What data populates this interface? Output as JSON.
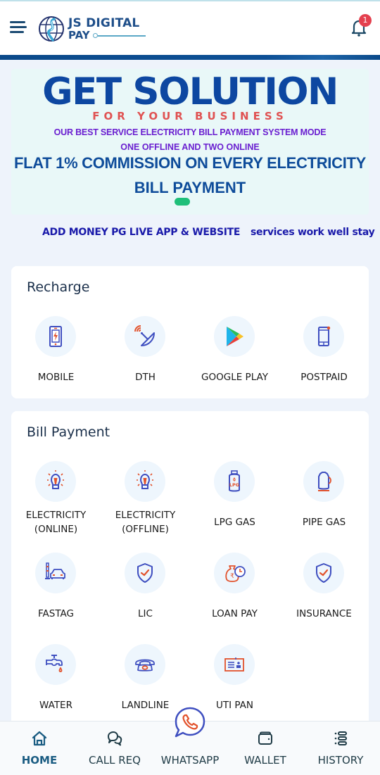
{
  "header": {
    "logo_line1": "JS DIGITAL",
    "logo_line2": "PAY",
    "notification_count": "1",
    "menu_icon": "hamburger-menu-icon",
    "bell_icon": "bell-icon"
  },
  "banner": {
    "title": "GET SOLUTION",
    "subtitle": "FOR YOUR BUSINESS",
    "line1": "OUR BEST SERVICE ELECTRICITY BILL PAYMENT SYSTEM MODE",
    "line2": "ONE OFFLINE AND TWO ONLINE",
    "line3": "FLAT 1% COMMISSION ON EVERY ELECTRICITY",
    "line4": "BILL PAYMENT",
    "active_slide_indicator": 1,
    "colors": {
      "title": "#0d47a1",
      "subtitle": "#e05353",
      "purple": "#6a1fd0",
      "indicator": "#1fbf79"
    }
  },
  "marquee": {
    "text1": "ADD MONEY PG LIVE APP & WEBSITE",
    "text2": "services work well stay"
  },
  "recharge": {
    "title": "Recharge",
    "items": [
      {
        "label": "MOBILE",
        "icon": "mobile-recharge-icon"
      },
      {
        "label": "DTH",
        "icon": "satellite-dish-icon"
      },
      {
        "label": "GOOGLE PLAY",
        "icon": "google-play-icon"
      },
      {
        "label": "POSTPAID",
        "icon": "postpaid-phone-icon"
      }
    ]
  },
  "bill_payment": {
    "title": "Bill Payment",
    "items": [
      {
        "label_line1": "ELECTRICITY",
        "label_line2": "(ONLINE)",
        "icon": "lightbulb-icon"
      },
      {
        "label_line1": "ELECTRICITY",
        "label_line2": "(OFFLINE)",
        "icon": "lightbulb-icon"
      },
      {
        "label_line1": "LPG GAS",
        "icon": "lpg-cylinder-icon"
      },
      {
        "label_line1": "PIPE GAS",
        "icon": "gas-cylinder-icon"
      },
      {
        "label_line1": "FASTAG",
        "icon": "toll-car-icon"
      },
      {
        "label_line1": "LIC",
        "icon": "shield-check-icon"
      },
      {
        "label_line1": "LOAN PAY",
        "icon": "money-bag-clock-icon"
      },
      {
        "label_line1": "INSURANCE",
        "icon": "shield-check-icon"
      },
      {
        "label_line1": "WATER",
        "icon": "water-tap-icon"
      },
      {
        "label_line1": "LANDLINE",
        "icon": "landline-phone-icon"
      },
      {
        "label_line1": "UTI PAN",
        "icon": "id-card-icon"
      }
    ]
  },
  "bottom_nav": {
    "items": [
      {
        "label": "HOME",
        "icon": "home-icon",
        "active": true
      },
      {
        "label": "CALL REQ",
        "icon": "chat-bubbles-icon",
        "active": false
      },
      {
        "label": "WHATSAPP",
        "icon": "whatsapp-icon",
        "active": false
      },
      {
        "label": "WALLET",
        "icon": "wallet-icon",
        "active": false
      },
      {
        "label": "HISTORY",
        "icon": "history-list-icon",
        "active": false
      }
    ]
  }
}
